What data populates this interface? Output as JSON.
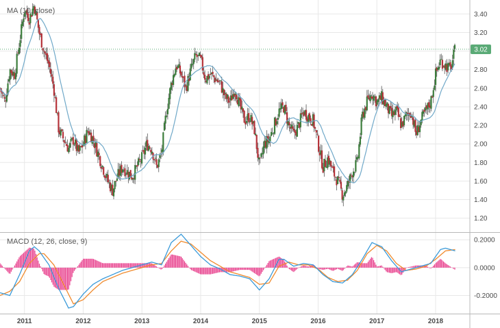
{
  "chart_data": [
    {
      "type": "candlestick",
      "title": "MA (10, close)",
      "y_axis_ticks": [
        "3.40",
        "3.20",
        "3.00",
        "2.80",
        "2.60",
        "2.40",
        "2.20",
        "2.00",
        "1.80",
        "1.60",
        "1.40",
        "1.20"
      ],
      "ylim": [
        1.05,
        3.55
      ],
      "last_price": "3.02",
      "colors": {
        "up": "#3b7d3b",
        "down": "#b5333a",
        "ma": "#6fa8c8",
        "grid": "#e8e8e8",
        "badge": "#5aaa76"
      },
      "close_path": [
        [
          "2010-08",
          2.6
        ],
        [
          "2010-09",
          2.45
        ],
        [
          "2010-10",
          2.8
        ],
        [
          "2010-11",
          2.75
        ],
        [
          "2010-12",
          3.1
        ],
        [
          "2011-01",
          3.45
        ],
        [
          "2011-02",
          3.35
        ],
        [
          "2011-03",
          3.5
        ],
        [
          "2011-04",
          3.2
        ],
        [
          "2011-05",
          3.0
        ],
        [
          "2011-06",
          2.85
        ],
        [
          "2011-07",
          2.6
        ],
        [
          "2011-08",
          2.15
        ],
        [
          "2011-09",
          2.05
        ],
        [
          "2011-10",
          1.95
        ],
        [
          "2011-11",
          2.05
        ],
        [
          "2011-12",
          1.9
        ],
        [
          "2012-01",
          2.0
        ],
        [
          "2012-02",
          2.15
        ],
        [
          "2012-03",
          2.05
        ],
        [
          "2012-04",
          1.9
        ],
        [
          "2012-05",
          1.75
        ],
        [
          "2012-06",
          1.6
        ],
        [
          "2012-07",
          1.5
        ],
        [
          "2012-08",
          1.65
        ],
        [
          "2012-09",
          1.75
        ],
        [
          "2012-10",
          1.7
        ],
        [
          "2012-11",
          1.65
        ],
        [
          "2012-12",
          1.75
        ],
        [
          "2013-01",
          1.85
        ],
        [
          "2013-02",
          2.0
        ],
        [
          "2013-03",
          1.95
        ],
        [
          "2013-04",
          1.75
        ],
        [
          "2013-05",
          1.9
        ],
        [
          "2013-06",
          2.35
        ],
        [
          "2013-07",
          2.65
        ],
        [
          "2013-08",
          2.85
        ],
        [
          "2013-09",
          2.75
        ],
        [
          "2013-10",
          2.6
        ],
        [
          "2013-11",
          2.8
        ],
        [
          "2013-12",
          2.95
        ],
        [
          "2014-01",
          2.9
        ],
        [
          "2014-02",
          2.7
        ],
        [
          "2014-03",
          2.75
        ],
        [
          "2014-04",
          2.7
        ],
        [
          "2014-05",
          2.65
        ],
        [
          "2014-06",
          2.5
        ],
        [
          "2014-07",
          2.45
        ],
        [
          "2014-08",
          2.6
        ],
        [
          "2014-09",
          2.4
        ],
        [
          "2014-10",
          2.25
        ],
        [
          "2014-11",
          2.3
        ],
        [
          "2014-12",
          2.15
        ],
        [
          "2015-01",
          1.75
        ],
        [
          "2015-02",
          2.0
        ],
        [
          "2015-03",
          2.05
        ],
        [
          "2015-04",
          2.2
        ],
        [
          "2015-05",
          2.35
        ],
        [
          "2015-06",
          2.4
        ],
        [
          "2015-07",
          2.2
        ],
        [
          "2015-08",
          2.1
        ],
        [
          "2015-09",
          2.2
        ],
        [
          "2015-10",
          2.35
        ],
        [
          "2015-11",
          2.3
        ],
        [
          "2015-12",
          2.25
        ],
        [
          "2016-01",
          2.0
        ],
        [
          "2016-02",
          1.75
        ],
        [
          "2016-03",
          1.85
        ],
        [
          "2016-04",
          1.7
        ],
        [
          "2016-05",
          1.6
        ],
        [
          "2016-06",
          1.45
        ],
        [
          "2016-07",
          1.55
        ],
        [
          "2016-08",
          1.7
        ],
        [
          "2016-09",
          1.8
        ],
        [
          "2016-10",
          2.3
        ],
        [
          "2016-11",
          2.45
        ],
        [
          "2016-12",
          2.55
        ],
        [
          "2017-01",
          2.45
        ],
        [
          "2017-02",
          2.5
        ],
        [
          "2017-03",
          2.4
        ],
        [
          "2017-04",
          2.3
        ],
        [
          "2017-05",
          2.35
        ],
        [
          "2017-06",
          2.2
        ],
        [
          "2017-07",
          2.3
        ],
        [
          "2017-08",
          2.35
        ],
        [
          "2017-09",
          2.1
        ],
        [
          "2017-10",
          2.25
        ],
        [
          "2017-11",
          2.35
        ],
        [
          "2017-12",
          2.45
        ],
        [
          "2018-01",
          2.75
        ],
        [
          "2018-02",
          2.9
        ],
        [
          "2018-03",
          2.85
        ],
        [
          "2018-04",
          2.8
        ],
        [
          "2018-05",
          3.02
        ]
      ]
    },
    {
      "type": "macd",
      "title": "MACD (12, 26, close, 9)",
      "y_axis_ticks": [
        "0.2000",
        "0.0000",
        "-0.2000"
      ],
      "ylim": [
        -0.33,
        0.25
      ],
      "colors": {
        "macd": "#3a9ad9",
        "signal": "#f08a2c",
        "histogram": "#e83e8c"
      },
      "macd_path": [
        [
          "2010-08",
          -0.18
        ],
        [
          "2010-10",
          -0.2
        ],
        [
          "2010-12",
          -0.05
        ],
        [
          "2011-02",
          0.12
        ],
        [
          "2011-03",
          0.15
        ],
        [
          "2011-04",
          0.12
        ],
        [
          "2011-06",
          0.02
        ],
        [
          "2011-08",
          -0.15
        ],
        [
          "2011-10",
          -0.29
        ],
        [
          "2011-11",
          -0.28
        ],
        [
          "2012-01",
          -0.19
        ],
        [
          "2012-03",
          -0.12
        ],
        [
          "2012-05",
          -0.08
        ],
        [
          "2012-07",
          -0.05
        ],
        [
          "2012-09",
          -0.02
        ],
        [
          "2012-11",
          0.0
        ],
        [
          "2013-01",
          0.02
        ],
        [
          "2013-03",
          0.04
        ],
        [
          "2013-05",
          0.02
        ],
        [
          "2013-07",
          0.18
        ],
        [
          "2013-09",
          0.24
        ],
        [
          "2013-11",
          0.16
        ],
        [
          "2014-01",
          0.08
        ],
        [
          "2014-03",
          0.02
        ],
        [
          "2014-05",
          -0.01
        ],
        [
          "2014-07",
          -0.05
        ],
        [
          "2014-09",
          -0.06
        ],
        [
          "2014-11",
          -0.08
        ],
        [
          "2015-01",
          -0.16
        ],
        [
          "2015-03",
          -0.08
        ],
        [
          "2015-05",
          0.06
        ],
        [
          "2015-06",
          0.06
        ],
        [
          "2015-08",
          0.01
        ],
        [
          "2015-10",
          0.03
        ],
        [
          "2015-12",
          0.02
        ],
        [
          "2016-02",
          -0.05
        ],
        [
          "2016-04",
          -0.1
        ],
        [
          "2016-06",
          -0.11
        ],
        [
          "2016-08",
          -0.05
        ],
        [
          "2016-10",
          0.06
        ],
        [
          "2016-12",
          0.18
        ],
        [
          "2017-02",
          0.15
        ],
        [
          "2017-04",
          0.05
        ],
        [
          "2017-06",
          -0.03
        ],
        [
          "2017-08",
          -0.01
        ],
        [
          "2017-10",
          0.01
        ],
        [
          "2017-12",
          0.03
        ],
        [
          "2018-02",
          0.13
        ],
        [
          "2018-03",
          0.14
        ],
        [
          "2018-05",
          0.12
        ]
      ],
      "signal_path": [
        [
          "2010-08",
          -0.2
        ],
        [
          "2010-10",
          -0.17
        ],
        [
          "2010-12",
          -0.1
        ],
        [
          "2011-02",
          0.03
        ],
        [
          "2011-04",
          0.1
        ],
        [
          "2011-05",
          0.1
        ],
        [
          "2011-07",
          0.02
        ],
        [
          "2011-09",
          -0.12
        ],
        [
          "2011-11",
          -0.26
        ],
        [
          "2012-01",
          -0.23
        ],
        [
          "2012-03",
          -0.16
        ],
        [
          "2012-05",
          -0.1
        ],
        [
          "2012-07",
          -0.07
        ],
        [
          "2012-09",
          -0.04
        ],
        [
          "2012-11",
          -0.02
        ],
        [
          "2013-01",
          0.0
        ],
        [
          "2013-03",
          0.02
        ],
        [
          "2013-05",
          0.03
        ],
        [
          "2013-07",
          0.12
        ],
        [
          "2013-09",
          0.19
        ],
        [
          "2013-11",
          0.17
        ],
        [
          "2014-01",
          0.11
        ],
        [
          "2014-03",
          0.05
        ],
        [
          "2014-05",
          0.01
        ],
        [
          "2014-07",
          -0.03
        ],
        [
          "2014-09",
          -0.05
        ],
        [
          "2014-11",
          -0.07
        ],
        [
          "2015-01",
          -0.12
        ],
        [
          "2015-03",
          -0.11
        ],
        [
          "2015-05",
          0.01
        ],
        [
          "2015-07",
          0.04
        ],
        [
          "2015-09",
          0.02
        ],
        [
          "2015-11",
          0.02
        ],
        [
          "2016-01",
          -0.01
        ],
        [
          "2016-03",
          -0.07
        ],
        [
          "2016-05",
          -0.1
        ],
        [
          "2016-07",
          -0.09
        ],
        [
          "2016-09",
          -0.02
        ],
        [
          "2016-11",
          0.1
        ],
        [
          "2017-01",
          0.16
        ],
        [
          "2017-03",
          0.12
        ],
        [
          "2017-05",
          0.03
        ],
        [
          "2017-07",
          -0.02
        ],
        [
          "2017-09",
          -0.01
        ],
        [
          "2017-11",
          0.01
        ],
        [
          "2018-01",
          0.06
        ],
        [
          "2018-03",
          0.12
        ],
        [
          "2018-05",
          0.13
        ]
      ]
    }
  ],
  "x_axis_ticks": [
    {
      "label": "2011",
      "date": "2011-01"
    },
    {
      "label": "2012",
      "date": "2012-01"
    },
    {
      "label": "2013",
      "date": "2013-01"
    },
    {
      "label": "2014",
      "date": "2014-01"
    },
    {
      "label": "2015",
      "date": "2015-01"
    },
    {
      "label": "2016",
      "date": "2016-01"
    },
    {
      "label": "2017",
      "date": "2017-01"
    },
    {
      "label": "2018",
      "date": "2018-01"
    }
  ],
  "x_range": [
    "2010-08",
    "2018-08"
  ]
}
